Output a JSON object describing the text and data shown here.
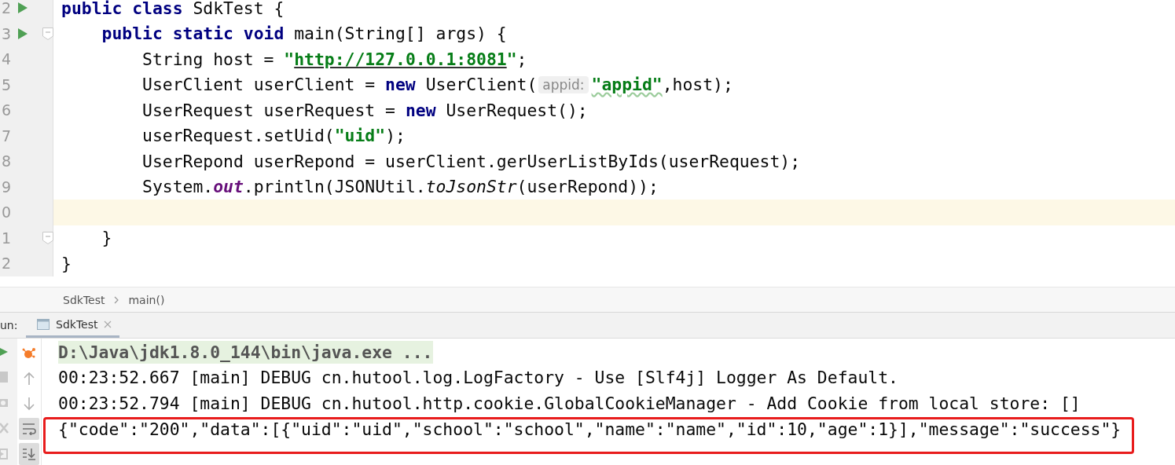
{
  "editor": {
    "lines": [
      {
        "number": "2",
        "run": true,
        "fold": false,
        "current": false,
        "tokens": [
          {
            "kind": "keyword",
            "text": "public class"
          },
          {
            "kind": "plain",
            "text": " SdkTest {"
          }
        ]
      },
      {
        "number": "3",
        "run": true,
        "fold": true,
        "current": false,
        "tokens": [
          {
            "kind": "keyword",
            "text": "    public static void"
          },
          {
            "kind": "plain",
            "text": " main(String[] args) {"
          }
        ]
      },
      {
        "number": "4",
        "run": false,
        "fold": false,
        "current": false,
        "tokens": [
          {
            "kind": "plain",
            "text": "        String host = "
          },
          {
            "kind": "string",
            "text": "\""
          },
          {
            "kind": "url",
            "text": "http://127.0.0.1:8081"
          },
          {
            "kind": "string",
            "text": "\""
          },
          {
            "kind": "plain",
            "text": ";"
          }
        ]
      },
      {
        "number": "5",
        "run": false,
        "fold": false,
        "current": false,
        "tokens": [
          {
            "kind": "plain",
            "text": "        UserClient userClient = "
          },
          {
            "kind": "keyword",
            "text": "new"
          },
          {
            "kind": "plain",
            "text": " UserClient("
          },
          {
            "kind": "hint",
            "text": "appid:"
          },
          {
            "kind": "typo",
            "text": "\"appid\""
          },
          {
            "kind": "plain",
            "text": ",host);"
          }
        ]
      },
      {
        "number": "6",
        "run": false,
        "fold": false,
        "current": false,
        "tokens": [
          {
            "kind": "plain",
            "text": "        UserRequest userRequest = "
          },
          {
            "kind": "keyword",
            "text": "new"
          },
          {
            "kind": "plain",
            "text": " UserRequest();"
          }
        ]
      },
      {
        "number": "7",
        "run": false,
        "fold": false,
        "current": false,
        "tokens": [
          {
            "kind": "plain",
            "text": "        userRequest.setUid("
          },
          {
            "kind": "string",
            "text": "\"uid\""
          },
          {
            "kind": "plain",
            "text": ");"
          }
        ]
      },
      {
        "number": "8",
        "run": false,
        "fold": false,
        "current": false,
        "tokens": [
          {
            "kind": "plain",
            "text": "        UserRepond userRepond = userClient.gerUserListByIds(userRequest);"
          }
        ]
      },
      {
        "number": "9",
        "run": false,
        "fold": false,
        "current": false,
        "tokens": [
          {
            "kind": "plain",
            "text": "        System."
          },
          {
            "kind": "field",
            "text": "out"
          },
          {
            "kind": "plain",
            "text": ".println(JSONUtil."
          },
          {
            "kind": "italic",
            "text": "toJsonStr"
          },
          {
            "kind": "plain",
            "text": "(userRepond));"
          }
        ]
      },
      {
        "number": "0",
        "run": false,
        "fold": false,
        "current": true
      },
      {
        "number": "1",
        "run": false,
        "fold": true,
        "current": false,
        "tokens": [
          {
            "kind": "plain",
            "text": "    }"
          }
        ]
      },
      {
        "number": "2",
        "run": false,
        "fold": false,
        "current": false,
        "tokens": [
          {
            "kind": "plain",
            "text": "}"
          }
        ]
      }
    ]
  },
  "breadcrumbs": [
    "SdkTest",
    "main()"
  ],
  "run_panel": {
    "label": "un:",
    "tabs": [
      {
        "label": "SdkTest",
        "selected": true
      }
    ]
  },
  "console_tools": [
    {
      "kind": "debug",
      "on": false
    },
    {
      "kind": "up",
      "on": false
    },
    {
      "kind": "down",
      "on": false
    },
    {
      "kind": "wrap",
      "on": true
    },
    {
      "kind": "scroll-end",
      "on": true
    }
  ],
  "console": [
    {
      "kind": "command",
      "text": "D:\\Java\\jdk1.8.0_144\\bin\\java.exe ...",
      "highlighted": false
    },
    {
      "kind": "log",
      "text": "00:23:52.667 [main] DEBUG cn.hutool.log.LogFactory - Use [Slf4j] Logger As Default.",
      "highlighted": false
    },
    {
      "kind": "log",
      "text": "00:23:52.794 [main] DEBUG cn.hutool.http.cookie.GlobalCookieManager - Add Cookie from local store: []",
      "highlighted": false
    },
    {
      "kind": "log",
      "text": "{\"code\":\"200\",\"data\":[{\"uid\":\"uid\",\"school\":\"school\",\"name\":\"name\",\"id\":10,\"age\":1}],\"message\":\"success\"}",
      "highlighted": true
    }
  ]
}
